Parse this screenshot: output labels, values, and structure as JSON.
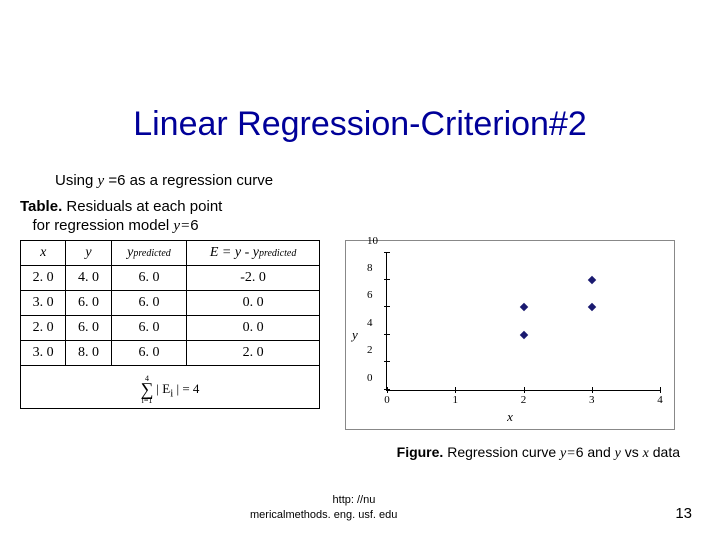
{
  "title": "Linear Regression-Criterion#2",
  "subtitle_prefix": "Using ",
  "subtitle_var": "y",
  "subtitle_eq": " =6 as a regression curve",
  "table_caption_bold": "Table.",
  "table_caption_line1": " Residuals at each point",
  "table_caption_line2_prefix": "for regression model ",
  "table_caption_line2_var": "y=",
  "table_caption_line2_val": "6",
  "headers": {
    "x": "x",
    "y": "y",
    "ypred": "y",
    "ypred_sub": "predicted",
    "err_prefix": "E = y - y",
    "err_sub": "predicted"
  },
  "rows": [
    {
      "x": "2. 0",
      "y": "4. 0",
      "yp": "6. 0",
      "e": "-2. 0"
    },
    {
      "x": "3. 0",
      "y": "6. 0",
      "yp": "6. 0",
      "e": "0. 0"
    },
    {
      "x": "2. 0",
      "y": "6. 0",
      "yp": "6. 0",
      "e": "0. 0"
    },
    {
      "x": "3. 0",
      "y": "8. 0",
      "yp": "6. 0",
      "e": "2. 0"
    }
  ],
  "sum": {
    "upper": "4",
    "lower": "i=1",
    "body": "| E",
    "body_sub": "i",
    "body_close": " | = ",
    "result": "4"
  },
  "chart_data": {
    "type": "scatter",
    "x": [
      2,
      3,
      2,
      3
    ],
    "y": [
      4,
      6,
      6,
      8
    ],
    "xlabel": "x",
    "ylabel": "y",
    "xlim": [
      0,
      4
    ],
    "ylim": [
      0,
      10
    ],
    "xticks": [
      0,
      1,
      2,
      3,
      4
    ],
    "yticks": [
      0,
      2,
      4,
      6,
      8,
      10
    ]
  },
  "fig_caption_bold": "Figure.",
  "fig_caption_text1": " Regression curve ",
  "fig_caption_eq": "y=",
  "fig_caption_eqval": "6 and ",
  "fig_caption_var_y": "y",
  "fig_caption_vs": " vs ",
  "fig_caption_var_x": "x",
  "fig_caption_end": " data",
  "footer_url_top": "http: //nu",
  "footer_url_bottom": "mericalmethods. eng. usf. edu",
  "page_number": "13"
}
